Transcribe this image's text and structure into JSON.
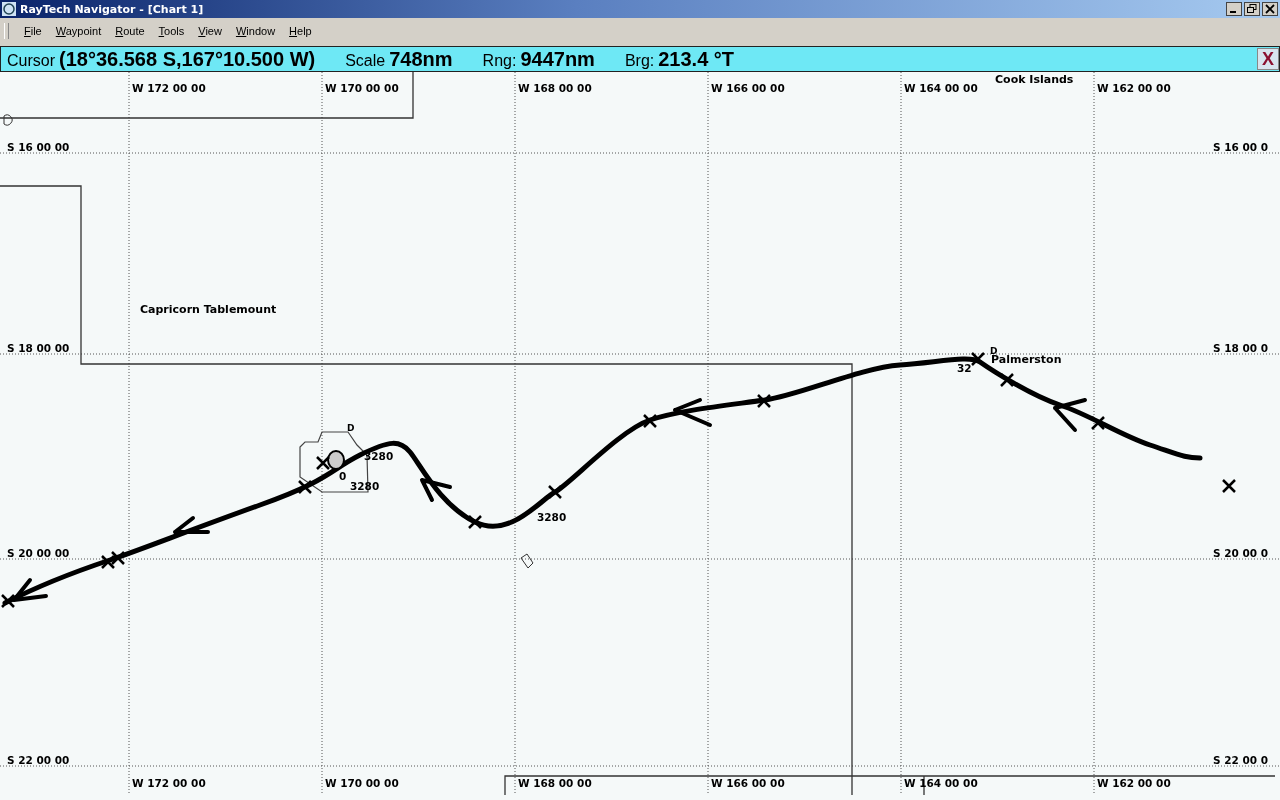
{
  "window": {
    "title": "RayTech Navigator - [Chart 1]"
  },
  "menu": [
    "File",
    "Waypoint",
    "Route",
    "Tools",
    "View",
    "Window",
    "Help"
  ],
  "cursor_bar": {
    "readouts": [
      {
        "label": "Cursor",
        "value": "(18°36.568 S,167°10.500 W)"
      },
      {
        "label": "Scale",
        "value": "748nm"
      },
      {
        "label": "Rng:",
        "value": "9447nm"
      },
      {
        "label": "Brg:",
        "value": "213.4 °T"
      }
    ],
    "close": "X"
  },
  "chart": {
    "lon_labels_top": [
      "W 172 00 00",
      "W 170 00 00",
      "W 168 00 00",
      "W 166 00 00",
      "W 164 00 00",
      "W 162 00 00"
    ],
    "lon_labels_bottom": [
      "W 172 00 00",
      "W 170 00 00",
      "W 168 00 00",
      "W 166 00 00",
      "W 164 00 00",
      "W 162 00 00"
    ],
    "lat_labels_left": [
      "S 16 00 00",
      "S 18 00 00",
      "S 20 00 00",
      "S 22 00 00"
    ],
    "lat_labels_right": [
      "S 16 00 0",
      "S 18 00 0",
      "S 20 00 0",
      "S 22 00 0"
    ],
    "places": [
      "Cook Islands",
      "Capricorn Tablemount",
      "Palmerston"
    ],
    "depths": [
      "3280",
      "0",
      "3280",
      "3280",
      "32"
    ],
    "marks": [
      "D",
      "D"
    ]
  }
}
